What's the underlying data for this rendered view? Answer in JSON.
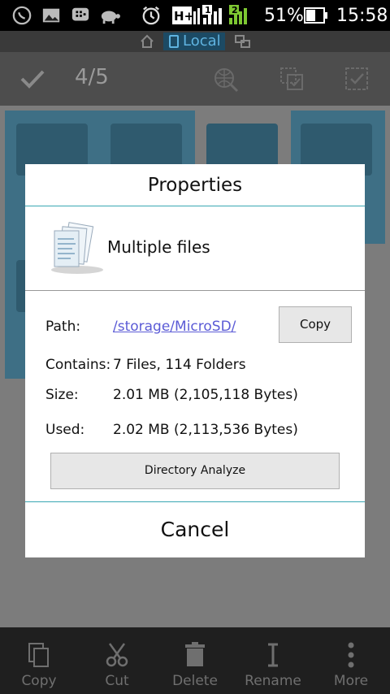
{
  "status_bar": {
    "battery": "51%",
    "time": "15:58",
    "network_type": "H+",
    "sim1_label": "1",
    "sim2_label": "2",
    "icons": [
      "whatsapp-icon",
      "gallery-icon",
      "bbm-icon",
      "turtle-icon",
      "alarm-icon",
      "signal-icon",
      "battery-icon"
    ]
  },
  "location_bar": {
    "label": "Local",
    "icons": [
      "home-icon",
      "phone-icon",
      "network-icon"
    ]
  },
  "action_bar": {
    "selection_count": "4/5",
    "icons": [
      "check-icon",
      "search-web-icon",
      "select-range-icon",
      "select-all-icon"
    ]
  },
  "dialog": {
    "title": "Properties",
    "item_label": "Multiple files",
    "path_label": "Path:",
    "path_value": "/storage/MicroSD/",
    "copy_label": "Copy",
    "contains_label": "Contains:",
    "contains_value": "7 Files, 114 Folders",
    "size_label": "Size:",
    "size_value": "2.01 MB (2,105,118 Bytes)",
    "used_label": "Used:",
    "used_value": "2.02 MB (2,113,536 Bytes)",
    "analyze_label": "Directory Analyze",
    "cancel_label": "Cancel"
  },
  "bottom_bar": {
    "items": [
      {
        "label": "Copy",
        "icon": "copy-icon"
      },
      {
        "label": "Cut",
        "icon": "scissors-icon"
      },
      {
        "label": "Delete",
        "icon": "trash-icon"
      },
      {
        "label": "Rename",
        "icon": "rename-icon"
      },
      {
        "label": "More",
        "icon": "more-vertical-icon"
      }
    ]
  },
  "colors": {
    "accent_teal": "#3aa7b3",
    "link_blue": "#5b5bd6",
    "location_blue": "#5fb3e0",
    "signal_green": "#7ec832"
  }
}
